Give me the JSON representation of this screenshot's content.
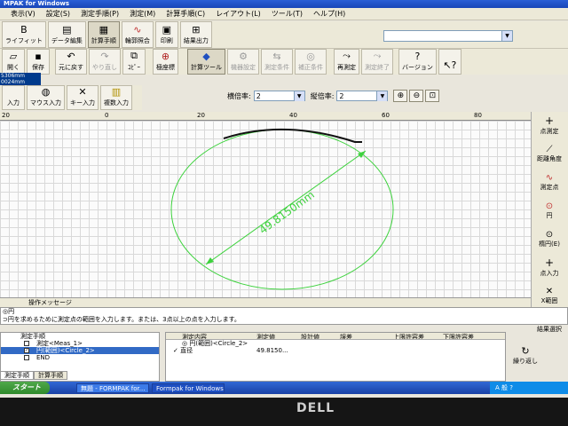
{
  "window": {
    "title": "MPAK for Windows"
  },
  "menu": [
    "表示(V)",
    "設定(S)",
    "測定手順(P)",
    "測定(M)",
    "計算手順(C)",
    "レイアウト(L)",
    "ツール(T)",
    "ヘルプ(H)"
  ],
  "toolbar1": [
    {
      "label": "ライフィット",
      "icon": "B"
    },
    {
      "label": "データ編集",
      "icon": "▤"
    },
    {
      "label": "計算手順",
      "icon": "▦"
    },
    {
      "label": "輪郭照合",
      "icon": "∿"
    },
    {
      "label": "印刷",
      "icon": "▣"
    },
    {
      "label": "結果出力",
      "icon": "⊞"
    }
  ],
  "toolbar2": [
    {
      "label": "開く",
      "icon": "▱"
    },
    {
      "label": "保存",
      "icon": "▪"
    },
    {
      "label": "元に戻す",
      "icon": "↶"
    },
    {
      "label": "やり直し",
      "icon": "↷"
    },
    {
      "label": "ｺﾋﾟｰ",
      "icon": "⧉"
    },
    {
      "label": "極座標",
      "icon": "⊕"
    },
    {
      "label": "計算ツール",
      "icon": "◆"
    },
    {
      "label": "機器設定",
      "icon": "⚙"
    },
    {
      "label": "測定条件",
      "icon": "⇆"
    },
    {
      "label": "補正条件",
      "icon": "◎"
    },
    {
      "label": "再測定",
      "icon": "⤳"
    },
    {
      "label": "測定終了",
      "icon": "⤳"
    },
    {
      "label": "バージョン",
      "icon": "?"
    },
    {
      "label": "",
      "icon": "↖?"
    }
  ],
  "coords": [
    "5306mm",
    "0024mm"
  ],
  "toolbar3": [
    {
      "label": "入力",
      "icon": ""
    },
    {
      "label": "マウス入力",
      "icon": "◍"
    },
    {
      "label": "キー入力",
      "icon": "✕"
    },
    {
      "label": "複数入力",
      "icon": "▥"
    }
  ],
  "magnification": {
    "h_label": "横倍率:",
    "h_value": "2",
    "v_label": "縦倍率:",
    "v_value": "2"
  },
  "ruler": [
    "20",
    "0",
    "20",
    "40",
    "60",
    "80"
  ],
  "drawing": {
    "dimension_label": "49.8150mm",
    "line_color": "#3cd23c"
  },
  "rightpanel": [
    "点測定",
    "距離角度",
    "測定点",
    "円",
    "楕円(E)",
    "点入力",
    "X範囲",
    "結果選択"
  ],
  "message": {
    "header": "操作メッセージ",
    "line1": "◎円",
    "line2": "⊃円を求めるために測定点の範囲を入力します。または、3点以上の点を入力します。"
  },
  "tree": [
    {
      "label": "測定手順",
      "checked": false,
      "selected": false
    },
    {
      "label": "測定<Meas_1>",
      "checked": false,
      "selected": false
    },
    {
      "label": "円(範囲)<Circle_2>",
      "checked": true,
      "selected": true
    },
    {
      "label": "END",
      "checked": false,
      "selected": false
    }
  ],
  "tree_tabs": [
    "測定手順",
    "計算手順"
  ],
  "result": {
    "headers": [
      "測定内容",
      "測定値",
      "設計値",
      "誤差",
      "上限許容差",
      "下限許容差"
    ],
    "rows": [
      [
        "◎ 円(範囲)<Circle_2>",
        "",
        "",
        "",
        "",
        ""
      ],
      [
        "直径",
        "49.8150...",
        "",
        "",
        "",
        ""
      ]
    ]
  },
  "repeat_label": "繰り返し",
  "taskbar": {
    "start": "スタート",
    "items": [
      "無題 - FORMPAK for...",
      "Formpak for Windows"
    ],
    "tray": "A 般 ?"
  },
  "monitor_logo": "DELL"
}
